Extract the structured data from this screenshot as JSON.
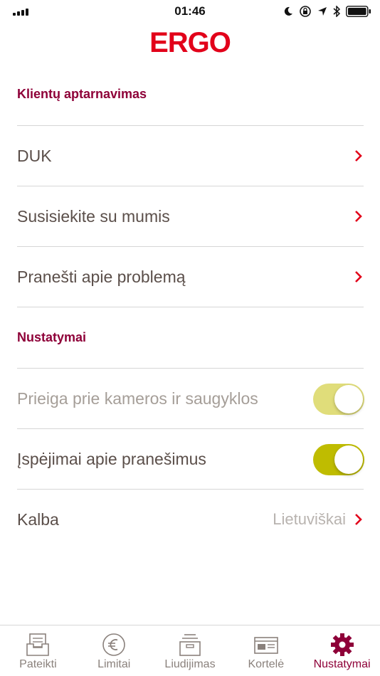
{
  "status_bar": {
    "time": "01:46"
  },
  "brand": {
    "logo_text": "ERGO"
  },
  "sections": {
    "customer_service": {
      "title": "Klientų aptarnavimas",
      "items": [
        {
          "label": "DUK"
        },
        {
          "label": "Susisiekite su mumis"
        },
        {
          "label": "Pranešti apie problemą"
        }
      ]
    },
    "settings": {
      "title": "Nustatymai",
      "camera_storage": {
        "label": "Prieiga prie kameros ir saugyklos",
        "enabled": true,
        "disabled_look": true
      },
      "notifications": {
        "label": "Įspėjimai apie pranešimus",
        "enabled": true
      },
      "language": {
        "label": "Kalba",
        "value": "Lietuviškai"
      }
    }
  },
  "tabbar": {
    "tabs": [
      {
        "label": "Pateikti",
        "icon": "tray-icon"
      },
      {
        "label": "Limitai",
        "icon": "euro-icon"
      },
      {
        "label": "Liudijimas",
        "icon": "archive-box-icon"
      },
      {
        "label": "Kortelė",
        "icon": "card-icon"
      },
      {
        "label": "Nustatymai",
        "icon": "gear-icon",
        "active": true
      }
    ]
  },
  "colors": {
    "brand_red": "#e2001a",
    "section_header": "#8e0038",
    "toggle_on": "#bfbc00",
    "toggle_on_disabled": "#e0dd7a"
  }
}
